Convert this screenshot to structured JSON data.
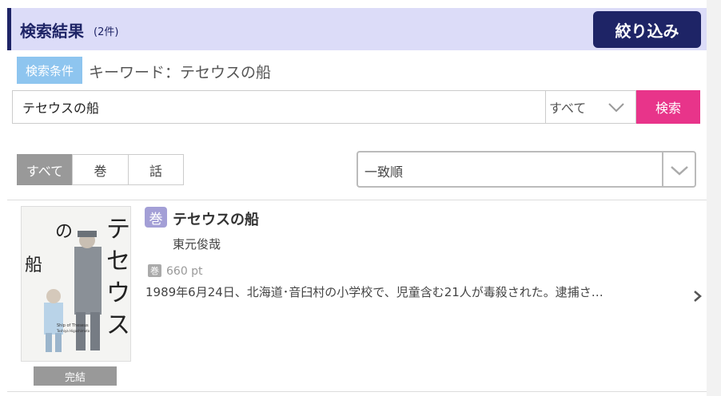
{
  "header": {
    "title": "検索結果",
    "count": "(2件)",
    "filter_label": "絞り込み"
  },
  "conditions": {
    "badge": "検索条件",
    "text": "キーワード：テセウスの船"
  },
  "search": {
    "value": "テセウスの船",
    "scope_selected": "すべて",
    "button_label": "検索"
  },
  "tabs": [
    {
      "label": "すべて",
      "active": true
    },
    {
      "label": "巻",
      "active": false
    },
    {
      "label": "話",
      "active": false
    }
  ],
  "sort": {
    "selected": "一致順"
  },
  "results": [
    {
      "badge": "巻",
      "title": "テセウスの船",
      "author": "東元俊哉",
      "price_badge": "巻",
      "price": "660 pt",
      "synopsis": "1989年6月24日、北海道･音臼村の小学校で、児童含む21人が毒殺された。逮捕さ…",
      "status": "完結",
      "cover": {
        "title_chars": "テセウスの船",
        "subtitle": "Ship of Theseus",
        "author_en": "Toshiya Higashimoto"
      }
    }
  ],
  "icons": {
    "select_chevron": "chevron-down-icon",
    "next": "chevron-right-icon"
  },
  "colors": {
    "brand_navy": "#1e2466",
    "header_bg": "#dcdcf8",
    "search_button": "#e8348a",
    "condition_badge": "#8ec5ef",
    "volume_badge": "#a39fd6"
  }
}
